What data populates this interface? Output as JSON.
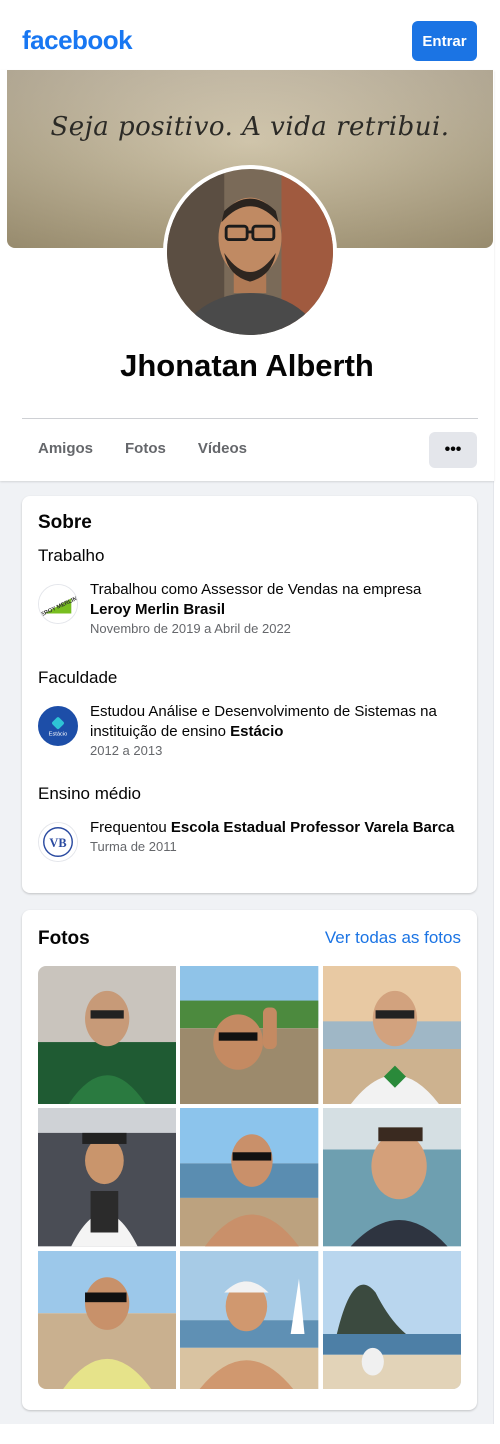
{
  "header": {
    "logo": "facebook",
    "login_label": "Entrar"
  },
  "profile": {
    "cover_text": "Seja positivo. A vida retribui.",
    "name": "Jhonatan Alberth",
    "tabs": [
      {
        "label": "Amigos"
      },
      {
        "label": "Fotos"
      },
      {
        "label": "Vídeos"
      }
    ],
    "more_label": "•••"
  },
  "about": {
    "title": "Sobre",
    "work": {
      "title": "Trabalho",
      "line_prefix": "Trabalhou como Assessor de Vendas na empresa",
      "company": "Leroy Merlin Brasil",
      "period": "Novembro de 2019 a Abril de 2022"
    },
    "college": {
      "title": "Faculdade",
      "line_prefix": "Estudou Análise e Desenvolvimento de Sistemas na instituição de ensino",
      "school": "Estácio",
      "period": "2012 a 2013",
      "logo_text": "Estácio"
    },
    "high_school": {
      "title": "Ensino médio",
      "line_prefix": "Frequentou",
      "school": "Escola Estadual Professor Varela Barca",
      "period": "Turma de 2011",
      "logo_text": "VB"
    }
  },
  "photos": {
    "title": "Fotos",
    "see_all": "Ver todas as fotos",
    "items": [
      {
        "scene": "selfie-green-shirt"
      },
      {
        "scene": "beach-selfie-sunglasses"
      },
      {
        "scene": "beach-sunset-selfie"
      },
      {
        "scene": "party-costume"
      },
      {
        "scene": "beach-shirtless"
      },
      {
        "scene": "airport-selfie"
      },
      {
        "scene": "beach-tanktop"
      },
      {
        "scene": "beach-cap"
      },
      {
        "scene": "sugarloaf-beach"
      }
    ]
  },
  "colors": {
    "brand": "#1877f2",
    "button": "#1b74e4",
    "link": "#1b74e4",
    "muted": "#65676b"
  }
}
